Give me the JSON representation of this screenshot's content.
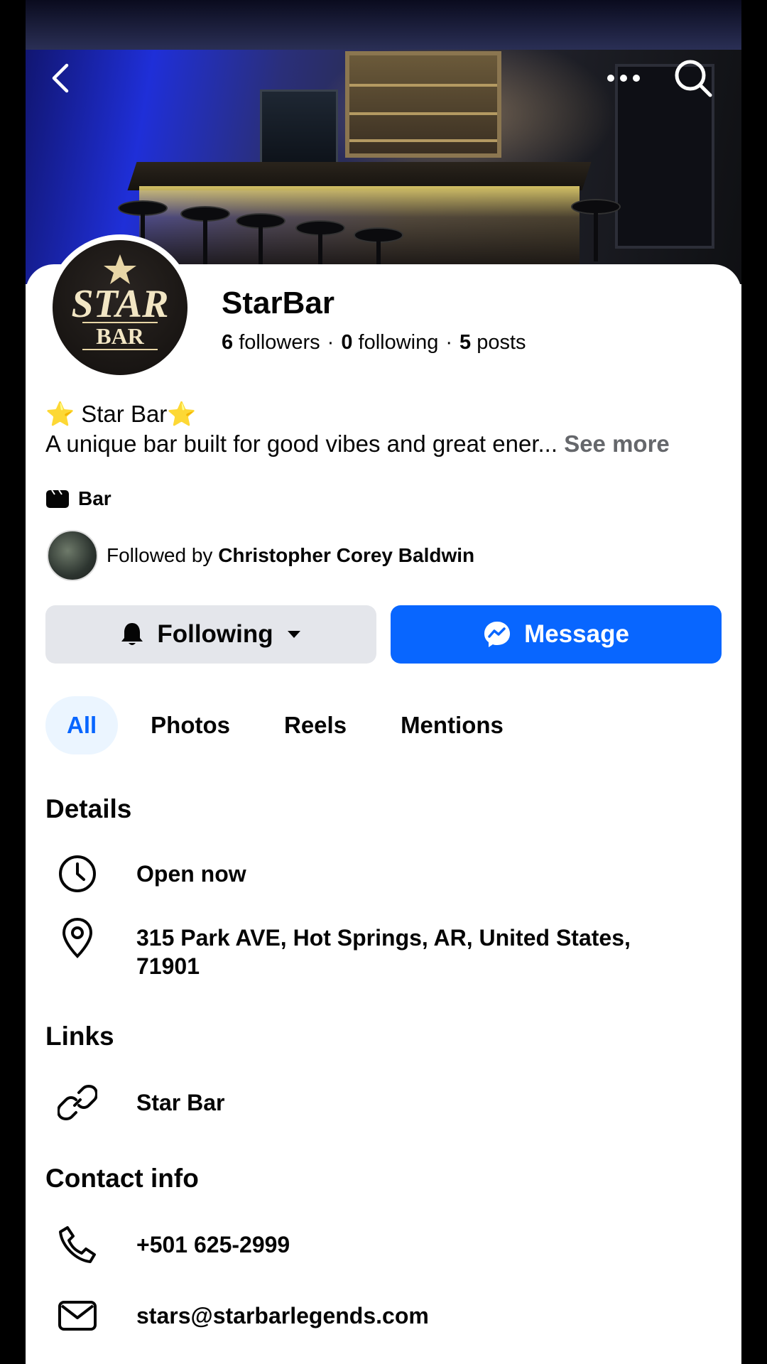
{
  "nav": {
    "back_icon": "chevron-left-icon",
    "more_icon": "more-horizontal-icon",
    "search_icon": "search-icon"
  },
  "profile": {
    "name": "StarBar",
    "logo_text_top": "STAR",
    "logo_text_bottom": "BAR",
    "followers_count": "6",
    "followers_label": "followers",
    "following_count": "0",
    "following_label": "following",
    "posts_count": "5",
    "posts_label": "posts",
    "separator": "·"
  },
  "bio": {
    "line1": "⭐ Star Bar⭐",
    "line2": "A unique bar built for good vibes and great ener...",
    "see_more": "See more"
  },
  "category": {
    "icon": "category-tag-icon",
    "label": "Bar"
  },
  "followed_by": {
    "prefix": "Followed by",
    "name": "Christopher Corey Baldwin"
  },
  "actions": {
    "following_label": "Following",
    "message_label": "Message",
    "colors": {
      "message_bg": "#0866ff",
      "following_bg": "#e4e6eb"
    }
  },
  "tabs": [
    {
      "label": "All",
      "active": true
    },
    {
      "label": "Photos",
      "active": false
    },
    {
      "label": "Reels",
      "active": false
    },
    {
      "label": "Mentions",
      "active": false
    }
  ],
  "details": {
    "title": "Details",
    "hours": "Open now",
    "address": "315 Park AVE, Hot Springs, AR, United States, 71901"
  },
  "links": {
    "title": "Links",
    "items": [
      {
        "label": "Star Bar"
      }
    ]
  },
  "contact": {
    "title": "Contact info",
    "phone": "+501 625-2999",
    "email": "stars@starbarlegends.com"
  }
}
